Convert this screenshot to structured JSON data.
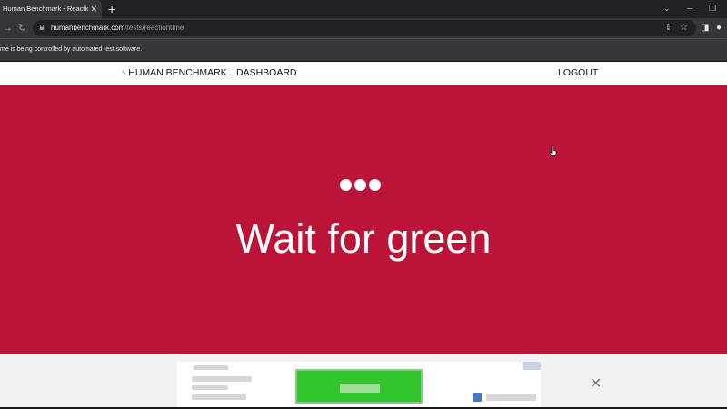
{
  "browser": {
    "tab_title": "Human Benchmark - Reaction Ti",
    "tab_close_glyph": "✕",
    "new_tab_glyph": "+",
    "url_host": "humanbenchmark.com",
    "url_path": "/tests/reactiontime",
    "automation_notice": "me is being controlled by automated test software."
  },
  "site_nav": {
    "logo_text": "HUMAN BENCHMARK",
    "dashboard": "DASHBOARD",
    "logout": "LOGOUT"
  },
  "test": {
    "headline": "Wait for green",
    "background_color": "#bc1438",
    "dots_count": 3
  },
  "ad": {
    "button_color": "#33c52e",
    "close_glyph": "✕"
  },
  "icons": {
    "tab_close": "close-icon",
    "forward": "forward-arrow-icon",
    "reload": "reload-icon",
    "lock": "lock-icon",
    "share": "share-icon",
    "bookmark": "star-icon",
    "sidebar": "sidebar-icon",
    "profile": "profile-icon",
    "logo": "lightning-bolt-icon",
    "cursor": "hand-pointer-icon"
  }
}
